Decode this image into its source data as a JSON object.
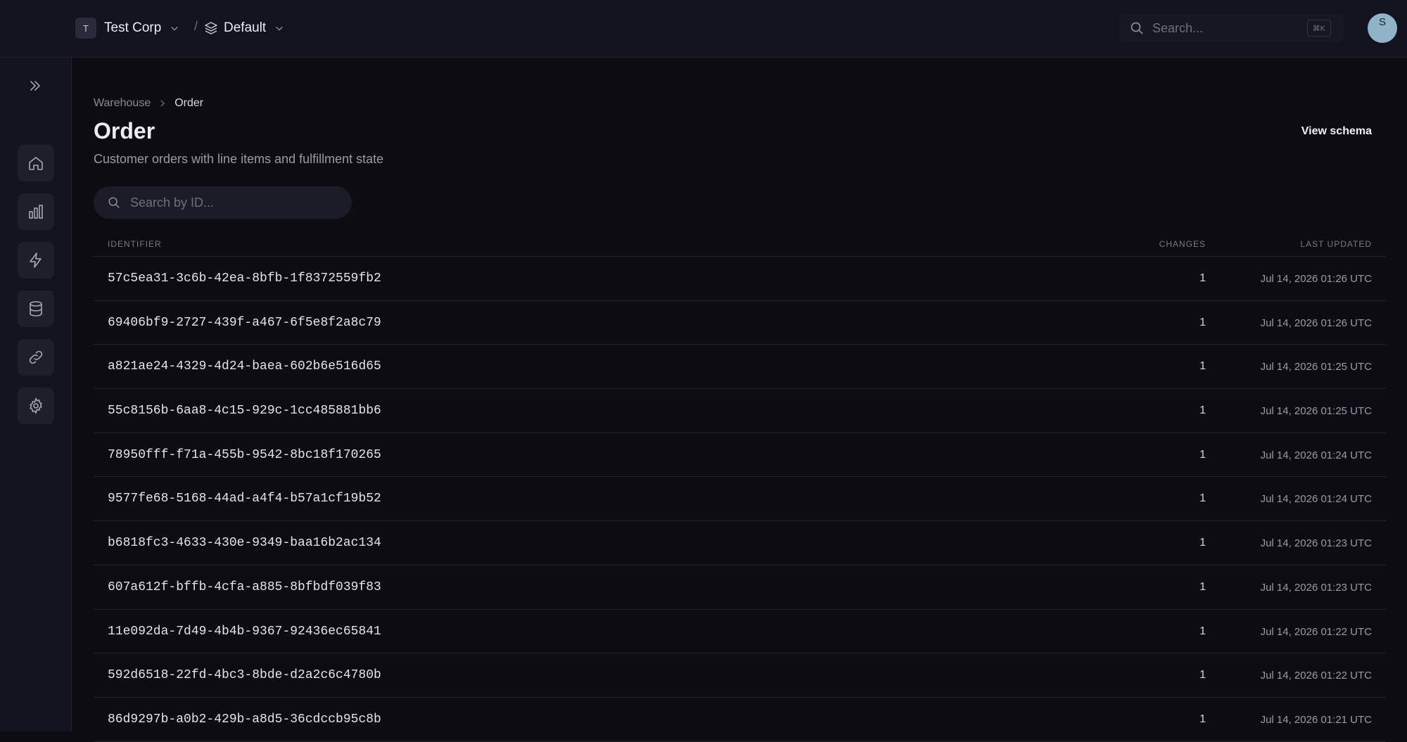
{
  "topbar": {
    "org": {
      "initial": "T",
      "name": "Test Corp"
    },
    "separator": "/",
    "environment": {
      "name": "Default"
    },
    "search": {
      "placeholder": "Search...",
      "shortcut": "⌘K"
    },
    "user": {
      "initial": "S"
    }
  },
  "sidebar": {
    "items": [
      {
        "name": "home",
        "icon": "home-icon"
      },
      {
        "name": "analytics",
        "icon": "bar-chart-icon"
      },
      {
        "name": "events",
        "icon": "lightning-icon"
      },
      {
        "name": "warehouse",
        "icon": "database-icon"
      },
      {
        "name": "integrations",
        "icon": "link-icon"
      },
      {
        "name": "settings",
        "icon": "gear-icon"
      }
    ]
  },
  "breadcrumb": {
    "parent": "Warehouse",
    "current": "Order"
  },
  "page": {
    "title": "Order",
    "subtitle": "Customer orders with line items and fulfillment state",
    "view_schema_label": "View schema",
    "search_placeholder": "Search by ID..."
  },
  "table": {
    "headers": {
      "identifier": "IDENTIFIER",
      "changes": "CHANGES",
      "last_updated": "LAST UPDATED"
    },
    "rows": [
      {
        "id": "57c5ea31-3c6b-42ea-8bfb-1f8372559fb2",
        "changes": "1",
        "updated": "Jul 14, 2026 01:26 UTC"
      },
      {
        "id": "69406bf9-2727-439f-a467-6f5e8f2a8c79",
        "changes": "1",
        "updated": "Jul 14, 2026 01:26 UTC"
      },
      {
        "id": "a821ae24-4329-4d24-baea-602b6e516d65",
        "changes": "1",
        "updated": "Jul 14, 2026 01:25 UTC"
      },
      {
        "id": "55c8156b-6aa8-4c15-929c-1cc485881bb6",
        "changes": "1",
        "updated": "Jul 14, 2026 01:25 UTC"
      },
      {
        "id": "78950fff-f71a-455b-9542-8bc18f170265",
        "changes": "1",
        "updated": "Jul 14, 2026 01:24 UTC"
      },
      {
        "id": "9577fe68-5168-44ad-a4f4-b57a1cf19b52",
        "changes": "1",
        "updated": "Jul 14, 2026 01:24 UTC"
      },
      {
        "id": "b6818fc3-4633-430e-9349-baa16b2ac134",
        "changes": "1",
        "updated": "Jul 14, 2026 01:23 UTC"
      },
      {
        "id": "607a612f-bffb-4cfa-a885-8bfbdf039f83",
        "changes": "1",
        "updated": "Jul 14, 2026 01:23 UTC"
      },
      {
        "id": "11e092da-7d49-4b4b-9367-92436ec65841",
        "changes": "1",
        "updated": "Jul 14, 2026 01:22 UTC"
      },
      {
        "id": "592d6518-22fd-4bc3-8bde-d2a2c6c4780b",
        "changes": "1",
        "updated": "Jul 14, 2026 01:22 UTC"
      },
      {
        "id": "86d9297b-a0b2-429b-a8d5-36cdccb95c8b",
        "changes": "1",
        "updated": "Jul 14, 2026 01:21 UTC"
      }
    ]
  },
  "colors": {
    "background": "#0c0c12",
    "topbar": "#131320",
    "text_primary": "#e4e4ec",
    "text_muted": "#9a9aa8",
    "avatar": "#8fb4c8"
  }
}
